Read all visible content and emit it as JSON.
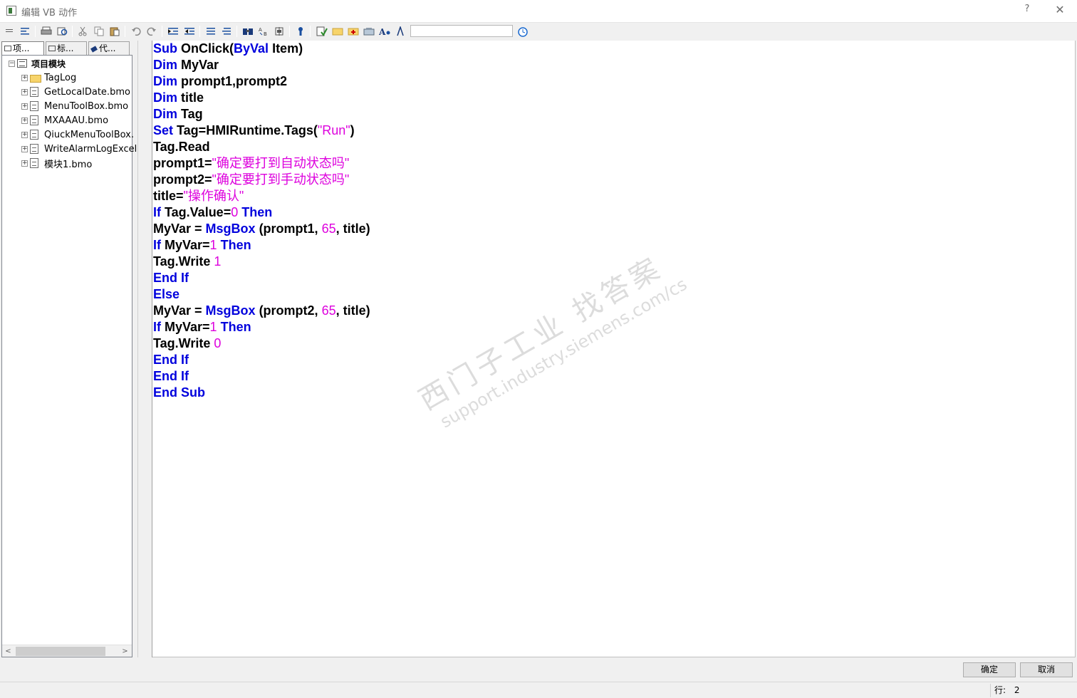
{
  "window": {
    "title": "编辑 VB 动作",
    "help_label": "?",
    "close_label": "✕"
  },
  "toolbar": {
    "buttons": [
      "menu-icon",
      "align-icon",
      "print-icon",
      "print-preview-icon",
      "cut-icon",
      "copy-icon",
      "paste-icon",
      "undo-icon",
      "redo-icon",
      "indent-icon",
      "outdent-icon",
      "comment-icon",
      "uncomment-icon",
      "find-icon",
      "replace-icon",
      "goto-icon",
      "info-icon",
      "syntax-check-icon",
      "folder-icon",
      "folder-add-icon",
      "tag-icon",
      "font-icon",
      "symbol-icon",
      "clock-icon"
    ],
    "search_value": ""
  },
  "sidebar": {
    "tabs": [
      "项...",
      "标...",
      "代..."
    ],
    "root_label": "项目模块",
    "items": [
      {
        "label": "TagLog",
        "type": "folder"
      },
      {
        "label": "GetLocalDate.bmo",
        "type": "doc"
      },
      {
        "label": "MenuToolBox.bmo",
        "type": "doc"
      },
      {
        "label": "MXAAAU.bmo",
        "type": "doc"
      },
      {
        "label": "QiuckMenuToolBox.",
        "type": "doc"
      },
      {
        "label": "WriteAlarmLogExcel.",
        "type": "doc"
      },
      {
        "label": "模块1.bmo",
        "type": "doc"
      }
    ],
    "scroll_left": "<",
    "scroll_right": ">"
  },
  "code": {
    "lines": [
      [
        {
          "t": "Sub",
          "c": "kw"
        },
        {
          "t": " OnClick(",
          "c": "id"
        },
        {
          "t": "ByVal",
          "c": "kw"
        },
        {
          "t": " Item)",
          "c": "id"
        }
      ],
      [
        {
          "t": "Dim",
          "c": "kw"
        },
        {
          "t": " MyVar",
          "c": "id"
        }
      ],
      [
        {
          "t": "Dim",
          "c": "kw"
        },
        {
          "t": " prompt1,prompt2",
          "c": "id"
        }
      ],
      [
        {
          "t": "Dim",
          "c": "kw"
        },
        {
          "t": " title",
          "c": "id"
        }
      ],
      [
        {
          "t": "Dim",
          "c": "kw"
        },
        {
          "t": " Tag",
          "c": "id"
        }
      ],
      [
        {
          "t": "Set",
          "c": "kw"
        },
        {
          "t": " Tag=HMIRuntime.Tags(",
          "c": "id"
        },
        {
          "t": "\"Run\"",
          "c": "str"
        },
        {
          "t": ")",
          "c": "id"
        }
      ],
      [
        {
          "t": "Tag.Read",
          "c": "id"
        }
      ],
      [
        {
          "t": "prompt1=",
          "c": "id"
        },
        {
          "t": "\"确定要打到自动状态吗\"",
          "c": "str"
        }
      ],
      [
        {
          "t": "prompt2=",
          "c": "id"
        },
        {
          "t": "\"确定要打到手动状态吗\"",
          "c": "str"
        }
      ],
      [
        {
          "t": "title=",
          "c": "id"
        },
        {
          "t": "\"操作确认\"",
          "c": "str"
        }
      ],
      [
        {
          "t": "If",
          "c": "kw"
        },
        {
          "t": " Tag.Value=",
          "c": "id"
        },
        {
          "t": "0",
          "c": "num"
        },
        {
          "t": " ",
          "c": "id"
        },
        {
          "t": "Then",
          "c": "kw"
        }
      ],
      [
        {
          "t": "MyVar = ",
          "c": "id"
        },
        {
          "t": "MsgBox",
          "c": "kw"
        },
        {
          "t": " (prompt1, ",
          "c": "id"
        },
        {
          "t": "65",
          "c": "num"
        },
        {
          "t": ", title)",
          "c": "id"
        }
      ],
      [
        {
          "t": "If",
          "c": "kw"
        },
        {
          "t": " MyVar=",
          "c": "id"
        },
        {
          "t": "1",
          "c": "num"
        },
        {
          "t": " ",
          "c": "id"
        },
        {
          "t": "Then",
          "c": "kw"
        }
      ],
      [
        {
          "t": "Tag.Write ",
          "c": "id"
        },
        {
          "t": "1",
          "c": "num"
        }
      ],
      [
        {
          "t": "End If",
          "c": "kw"
        }
      ],
      [
        {
          "t": "Else",
          "c": "kw"
        }
      ],
      [
        {
          "t": "MyVar = ",
          "c": "id"
        },
        {
          "t": "MsgBox",
          "c": "kw"
        },
        {
          "t": " (prompt2, ",
          "c": "id"
        },
        {
          "t": "65",
          "c": "num"
        },
        {
          "t": ", title)",
          "c": "id"
        }
      ],
      [
        {
          "t": "If",
          "c": "kw"
        },
        {
          "t": " MyVar=",
          "c": "id"
        },
        {
          "t": "1",
          "c": "num"
        },
        {
          "t": " ",
          "c": "id"
        },
        {
          "t": "Then",
          "c": "kw"
        }
      ],
      [
        {
          "t": "Tag.Write ",
          "c": "id"
        },
        {
          "t": "0",
          "c": "num"
        }
      ],
      [
        {
          "t": "End If",
          "c": "kw"
        }
      ],
      [
        {
          "t": "End If",
          "c": "kw"
        }
      ],
      [
        {
          "t": "End Sub",
          "c": "kw"
        }
      ]
    ]
  },
  "watermark": {
    "line1": "西门子工业 找答案",
    "line2": "support.industry.siemens.com/cs"
  },
  "buttons": {
    "ok_label": "确定",
    "cancel_label": "取消"
  },
  "status": {
    "line_label": "行:",
    "line_value": "2"
  },
  "colors": {
    "keyword": "#0000dd",
    "literal": "#dd00dd",
    "identifier": "#000000"
  }
}
